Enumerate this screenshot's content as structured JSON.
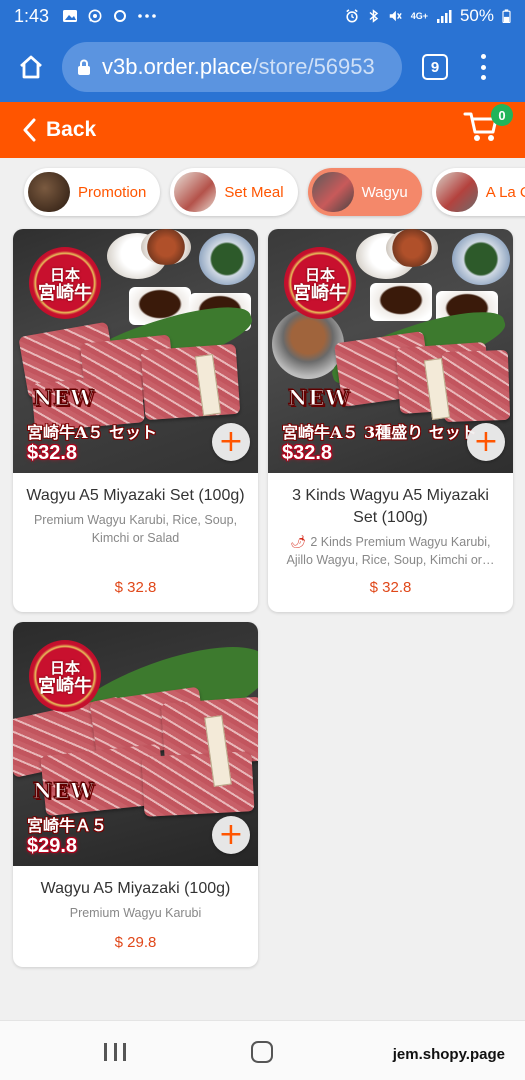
{
  "status": {
    "time": "1:43",
    "left_icons": [
      "image-icon",
      "whatsapp-icon",
      "circle-icon",
      "more-icon"
    ],
    "right_icons": [
      "alarm-icon",
      "bluetooth-icon",
      "mute-icon",
      "wifi-4g-icon",
      "signal-icon"
    ],
    "network": "4G+",
    "battery": "50%"
  },
  "browser": {
    "url_host": "v3b.order.place",
    "url_path": "/store/56953",
    "tab_count": "9"
  },
  "header": {
    "back_label": "Back",
    "cart_count": "0"
  },
  "categories": [
    {
      "label": "Promotion",
      "active": false
    },
    {
      "label": "Set Meal",
      "active": false
    },
    {
      "label": "Wagyu",
      "active": true
    },
    {
      "label": "A La Carte",
      "active": false
    }
  ],
  "products": [
    {
      "name": "Wagyu A5 Miyazaki Set (100g)",
      "description": "Premium Wagyu Karubi, Rice, Soup, Kimchi or Salad",
      "price": "$ 32.8",
      "image_badge": "NEW",
      "image_title": "宮崎牛A５ セット",
      "image_price": "$32.8",
      "seal_top": "日本",
      "seal_main": "宮崎牛"
    },
    {
      "name": "3 Kinds Wagyu A5 Miyazaki Set (100g)",
      "description": "2 Kinds Premium Wagyu Karubi, Ajillo Wagyu, Rice, Soup, Kimchi or…",
      "price": "$ 32.8",
      "image_badge": "NEW",
      "image_title": "宮崎牛A５ 3種盛り セット",
      "image_price": "$32.8",
      "seal_top": "日本",
      "seal_main": "宮崎牛"
    },
    {
      "name": "Wagyu A5 Miyazaki (100g)",
      "description": "Premium Wagyu Karubi",
      "price": "$ 29.8",
      "image_badge": "NEW",
      "image_title": "宮崎牛Ａ５",
      "image_price": "$29.8",
      "seal_top": "日本",
      "seal_main": "宮崎牛"
    }
  ],
  "watermark": "jem.shopy.page",
  "colors": {
    "brand": "#ff5500",
    "browser": "#2a73d3",
    "price": "#e0481a",
    "cart_badge": "#22b45a"
  }
}
